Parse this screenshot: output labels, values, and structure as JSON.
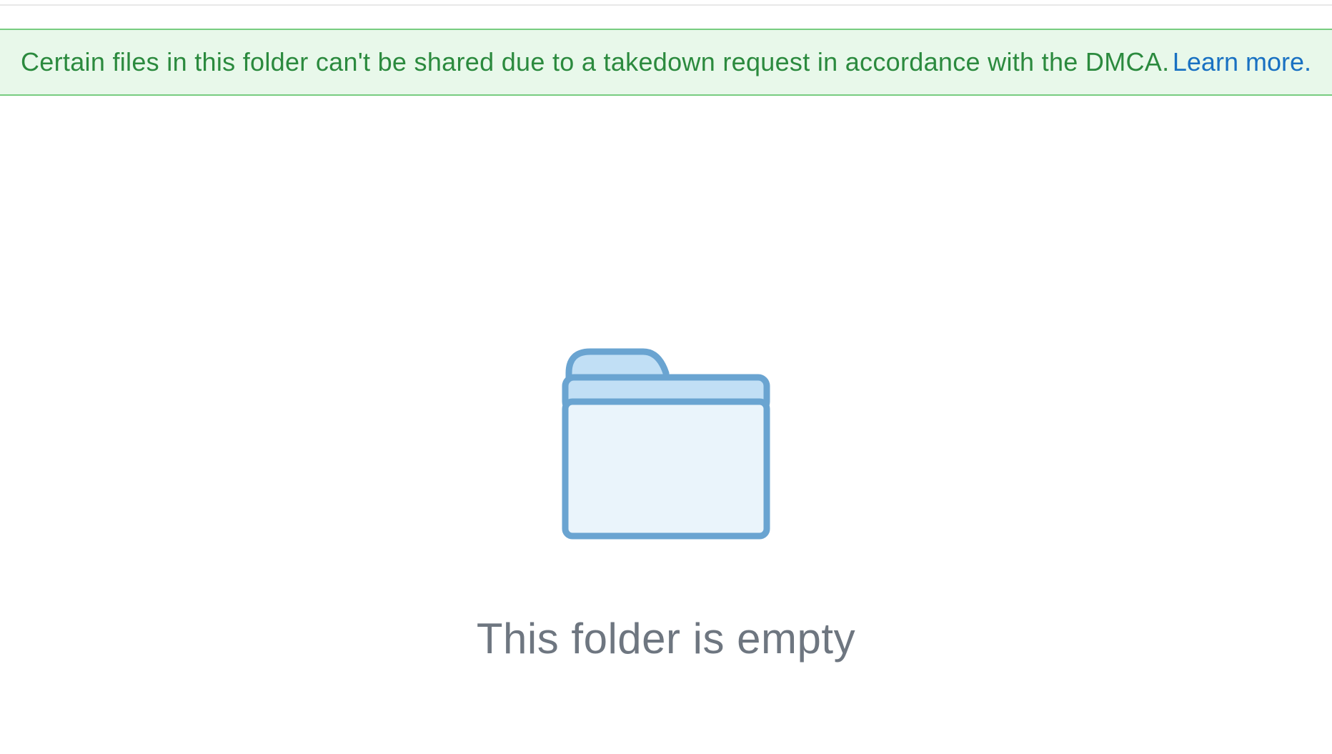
{
  "notice": {
    "message": "Certain files in this folder can't be shared due to a takedown request in accordance with the DMCA.",
    "link_label": "Learn more."
  },
  "empty_state": {
    "heading": "This folder is empty"
  },
  "colors": {
    "banner_bg": "#e8f8ea",
    "banner_border": "#77cc80",
    "banner_text": "#2b8a3e",
    "link": "#1971c2",
    "muted_text": "#6e7680",
    "folder_stroke": "#6aa4d1",
    "folder_tab_fill": "#c1dff5",
    "folder_body_fill": "#eaf4fb"
  }
}
